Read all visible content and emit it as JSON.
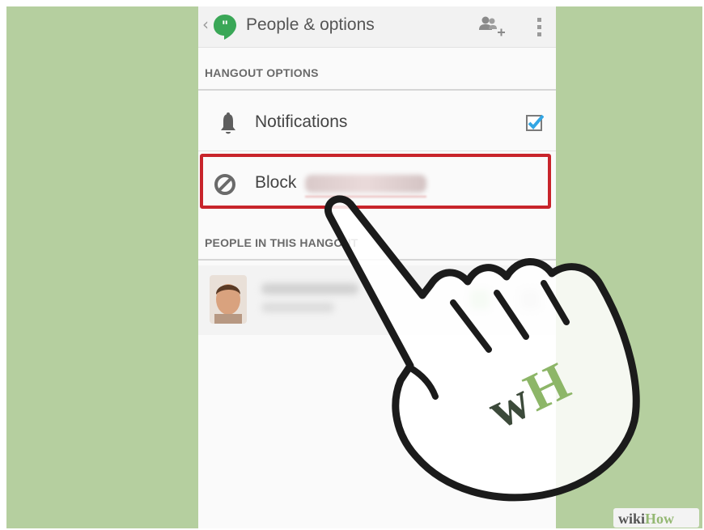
{
  "action_bar": {
    "title": "People & options",
    "icons": [
      "chevron-left-icon",
      "hangouts-logo-icon",
      "add-people-icon",
      "overflow-menu-icon"
    ]
  },
  "sections": {
    "hangout_options": "HANGOUT OPTIONS",
    "people_in_this_hangout": "PEOPLE IN THIS HANGOUT"
  },
  "options": {
    "notifications_label": "Notifications",
    "notifications_checked": true,
    "block_label": "Block"
  },
  "watermark": {
    "badge_wiki": "wiki",
    "badge_how": "How"
  },
  "colors": {
    "background_green": "#b5cf9f",
    "highlight_red": "#c8242b",
    "checkbox_blue": "#33a6e4",
    "hangouts_green": "#3aa757",
    "wh_dark": "#3c4a3a",
    "wh_light": "#8db668"
  }
}
